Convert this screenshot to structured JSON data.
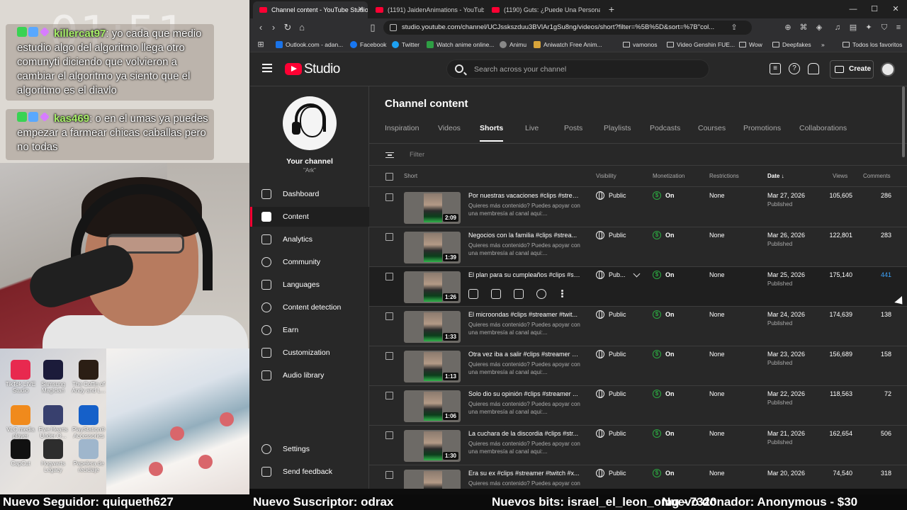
{
  "overlay": {
    "clock": "01:51",
    "chat": [
      {
        "user": "killercat97",
        "message": ": yo cada que medio estudio algo del algoritmo llega otro comunyti diciendo que volvieron a cambiar el algoritmo ya siento que el algoritmo es el diavlo"
      },
      {
        "user": "kas469",
        "message": ": o en el umas ya puedes empezar a farmear chicas caballas pero no todas"
      }
    ],
    "desktop_icons": [
      {
        "label": "TikTok LIVE Studio",
        "color": "#e8294f"
      },
      {
        "label": "Samsung Magician",
        "color": "#1b1b3a"
      },
      {
        "label": "The Coffin of Andy and L...",
        "color": "#2b1e14"
      },
      {
        "label": "VLC media player",
        "color": "#f08a1c"
      },
      {
        "label": "Five Hearts Under O...",
        "color": "#38406e"
      },
      {
        "label": "PlayStation® Accessories",
        "color": "#1560c9"
      },
      {
        "label": "CapCut",
        "color": "#111111"
      },
      {
        "label": "Hogwarts Legacy",
        "color": "#2d2d2d"
      },
      {
        "label": "Papelera de reciclaje",
        "color": "#9fb6cc"
      }
    ],
    "ticker": {
      "follower": "Nuevo Seguidor: quiqueth627",
      "subscriber": "Nuevo Suscriptor: odrax",
      "bits": "Nuevos bits: israel_el_leon_omg - 7320",
      "donor": "Nuevo donador: Anonymous - $30"
    }
  },
  "browser": {
    "tabs": [
      {
        "title": "Channel content - YouTube Studio",
        "active": true
      },
      {
        "title": "(1191) JaidenAnimations - YouTube",
        "active": false
      },
      {
        "title": "(1190) Guts: ¿Puede Una Persona Ca...",
        "active": false
      }
    ],
    "url": "studio.youtube.com/channel/UCJsskszduu3BVlAr1gSu8ng/videos/short?filter=%5B%5D&sort=%7B\"col...",
    "bookmarks": [
      {
        "label": "Outlook.com - adan...",
        "color": "#1a73e8"
      },
      {
        "label": "Facebook",
        "color": "#1877f2"
      },
      {
        "label": "Twitter",
        "color": "#1da1f2"
      },
      {
        "label": "Watch anime online...",
        "color": "#2e9e44"
      },
      {
        "label": "Animu",
        "color": "#888888"
      },
      {
        "label": "Aniwatch Free Anim...",
        "color": "#d8a43a"
      },
      {
        "label": "vamonos",
        "color": "folder"
      },
      {
        "label": "Video Genshin FUE...",
        "color": "folder"
      },
      {
        "label": "Wow",
        "color": "folder"
      },
      {
        "label": "Deepfakes",
        "color": "folder"
      },
      {
        "label": "Todos los favoritos",
        "color": "folder"
      }
    ]
  },
  "studio": {
    "logo_text": "Studio",
    "search_placeholder": "Search across your channel",
    "create_label": "Create",
    "channel": {
      "name": "Your channel",
      "handle": "\"Ark\""
    },
    "nav": [
      {
        "label": "Dashboard",
        "active": false
      },
      {
        "label": "Content",
        "active": true
      },
      {
        "label": "Analytics",
        "active": false
      },
      {
        "label": "Community",
        "active": false
      },
      {
        "label": "Languages",
        "active": false
      },
      {
        "label": "Content detection",
        "active": false
      },
      {
        "label": "Earn",
        "active": false
      },
      {
        "label": "Customization",
        "active": false
      },
      {
        "label": "Audio library",
        "active": false
      }
    ],
    "nav_bottom": [
      {
        "label": "Settings"
      },
      {
        "label": "Send feedback"
      }
    ],
    "page_title": "Channel content",
    "tabs": [
      {
        "label": "Inspiration",
        "active": false
      },
      {
        "label": "Videos",
        "active": false
      },
      {
        "label": "Shorts",
        "active": true
      },
      {
        "label": "Live",
        "active": false
      },
      {
        "label": "Posts",
        "active": false
      },
      {
        "label": "Playlists",
        "active": false
      },
      {
        "label": "Podcasts",
        "active": false
      },
      {
        "label": "Courses",
        "active": false
      },
      {
        "label": "Promotions",
        "active": false
      },
      {
        "label": "Collaborations",
        "active": false
      }
    ],
    "filter_placeholder": "Filter",
    "columns": {
      "short": "Short",
      "visibility": "Visibility",
      "monetization": "Monetization",
      "restrictions": "Restrictions",
      "date": "Date",
      "views": "Views",
      "comments": "Comments"
    },
    "description_preview": "Quieres más contenido? Puedes apoyar con una membresía al canal aqui:...",
    "rows": [
      {
        "title": "Por nuestras vacaciones #clips #strea...",
        "duration": "2:09",
        "visibility": "Public",
        "monetization": "On",
        "restrictions": "None",
        "date": "Mar 27, 2026",
        "status": "Published",
        "views": "105,605",
        "comments": "286"
      },
      {
        "title": "Negocios con la familia #clips #strea...",
        "duration": "1:39",
        "visibility": "Public",
        "monetization": "On",
        "restrictions": "None",
        "date": "Mar 26, 2026",
        "status": "Published",
        "views": "122,801",
        "comments": "283"
      },
      {
        "title": "El plan para su cumpleaños #clips #st...",
        "duration": "1:26",
        "visibility": "Pub...",
        "monetization": "On",
        "restrictions": "None",
        "date": "Mar 25, 2026",
        "status": "Published",
        "views": "175,140",
        "comments": "441",
        "hover": true
      },
      {
        "title": "El microondas #clips #streamer #twit...",
        "duration": "1:33",
        "visibility": "Public",
        "monetization": "On",
        "restrictions": "None",
        "date": "Mar 24, 2026",
        "status": "Published",
        "views": "174,639",
        "comments": "138"
      },
      {
        "title": "Otra vez iba a salir #clips #streamer #...",
        "duration": "1:13",
        "visibility": "Public",
        "monetization": "On",
        "restrictions": "None",
        "date": "Mar 23, 2026",
        "status": "Published",
        "views": "156,689",
        "comments": "158"
      },
      {
        "title": "Solo dio su opinión #clips #streamer ...",
        "duration": "1:06",
        "visibility": "Public",
        "monetization": "On",
        "restrictions": "None",
        "date": "Mar 22, 2026",
        "status": "Published",
        "views": "118,563",
        "comments": "72"
      },
      {
        "title": "La cuchara de la discordia #clips #str...",
        "duration": "1:30",
        "visibility": "Public",
        "monetization": "On",
        "restrictions": "None",
        "date": "Mar 21, 2026",
        "status": "Published",
        "views": "162,654",
        "comments": "506"
      },
      {
        "title": "Era su ex #clips #streamer #twitch #x...",
        "duration": "",
        "visibility": "Public",
        "monetization": "On",
        "restrictions": "None",
        "date": "Mar 20, 2026",
        "status": "",
        "views": "74,540",
        "comments": "318"
      }
    ]
  }
}
